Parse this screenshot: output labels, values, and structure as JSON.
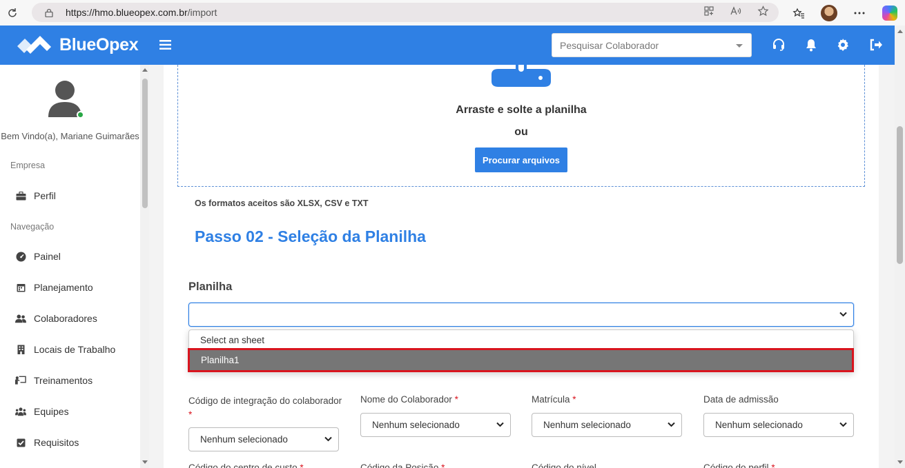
{
  "browser": {
    "url_host": "https://hmo.blueopex.com.br",
    "url_path": "/import"
  },
  "header": {
    "brand": "BlueOpex",
    "search_placeholder": "Pesquisar Colaborador",
    "accent_color": "#2f80e4"
  },
  "sidebar": {
    "welcome": "Bem Vindo(a), Mariane Guimarães",
    "sections": [
      {
        "label": "Empresa",
        "items": [
          {
            "label": "Perfil",
            "icon": "briefcase-icon"
          }
        ]
      },
      {
        "label": "Navegação",
        "items": [
          {
            "label": "Painel",
            "icon": "dashboard-icon"
          },
          {
            "label": "Planejamento",
            "icon": "calendar-icon"
          },
          {
            "label": "Colaboradores",
            "icon": "users-icon"
          },
          {
            "label": "Locais de Trabalho",
            "icon": "building-icon"
          },
          {
            "label": "Treinamentos",
            "icon": "chalkboard-icon"
          },
          {
            "label": "Equipes",
            "icon": "team-icon"
          },
          {
            "label": "Requisitos",
            "icon": "checkbox-icon"
          }
        ]
      }
    ]
  },
  "dropzone": {
    "title": "Arraste e solte a planilha",
    "or": "ou",
    "browse_button": "Procurar arquivos",
    "formats_note": "Os formatos aceitos são XLSX, CSV e TXT"
  },
  "step2": {
    "title": "Passo 02 - Seleção da Planilha",
    "field_label": "Planilha",
    "value": "",
    "options": [
      "Select an sheet",
      "Planilha1"
    ],
    "highlighted_option": "Planilha1"
  },
  "mapping": {
    "fields": [
      {
        "label": "Código de integração do colaborador",
        "required": true,
        "value": "Nenhum selecionado"
      },
      {
        "label": "Nome do Colaborador",
        "required": true,
        "value": "Nenhum selecionado"
      },
      {
        "label": "Matrícula",
        "required": true,
        "value": "Nenhum selecionado"
      },
      {
        "label": "Data de admissão",
        "required": false,
        "value": "Nenhum selecionado"
      }
    ],
    "next_row_labels": [
      "Código do centro de custo",
      "Código da Posição",
      "Código do nível",
      "Código do perfil"
    ]
  },
  "required_mark": "*"
}
